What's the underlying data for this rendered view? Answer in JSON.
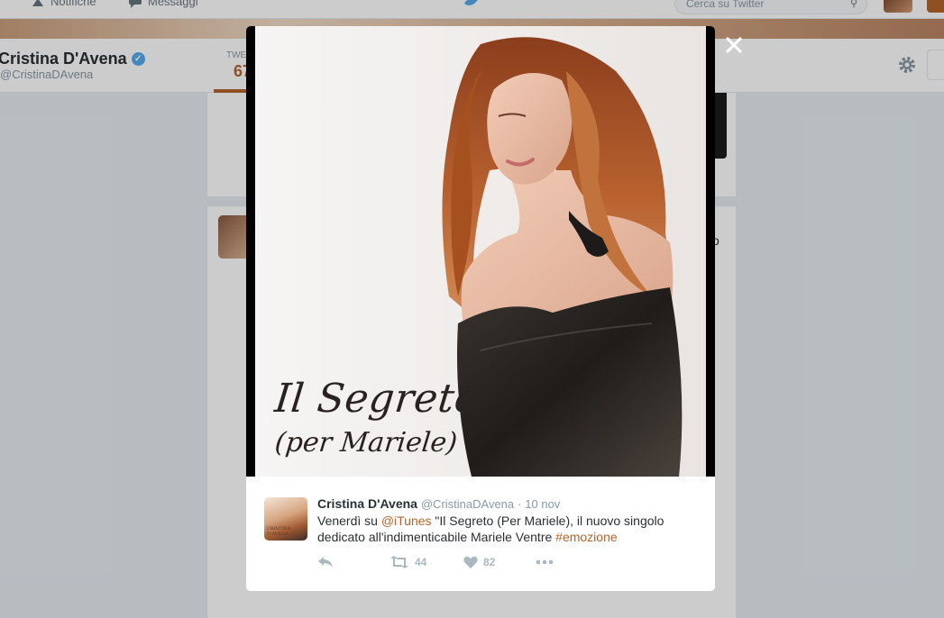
{
  "topbar": {
    "notifications_label": "Notifiche",
    "messages_label": "Messaggi",
    "search_placeholder": "Cerca su Twitter"
  },
  "profile": {
    "name": "Cristina D'Avena",
    "handle": "@CristinaDAvena",
    "stat_label": "TWE",
    "stat_value": "67"
  },
  "background_fragment": "o",
  "media": {
    "title_line1": "Il Segreto",
    "title_line2": "(per Mariele)"
  },
  "tweet": {
    "author_name": "Cristina D'Avena",
    "author_handle": "@CristinaDAvena",
    "separator": "·",
    "time": "10 nov",
    "avatar_text": "CRISTINA D'AVENA",
    "text_part1": "Venerdì su ",
    "mention": "@iTunes",
    "text_part2": " \"Il Segreto (Per Mariele), il nuovo singolo dedicato all'indimenticabile Mariele Ventre ",
    "hashtag": "#emozione",
    "retweet_count": "44",
    "like_count": "82"
  },
  "colors": {
    "accent": "#b3652b",
    "verified": "#55acee",
    "muted": "#8899a6",
    "action": "#aab8c2"
  },
  "icons": [
    "notifications-icon",
    "messages-icon",
    "twitter-bird-icon",
    "search-icon",
    "verified-icon",
    "gear-icon",
    "close-icon",
    "reply-icon",
    "retweet-icon",
    "like-icon",
    "more-icon"
  ]
}
